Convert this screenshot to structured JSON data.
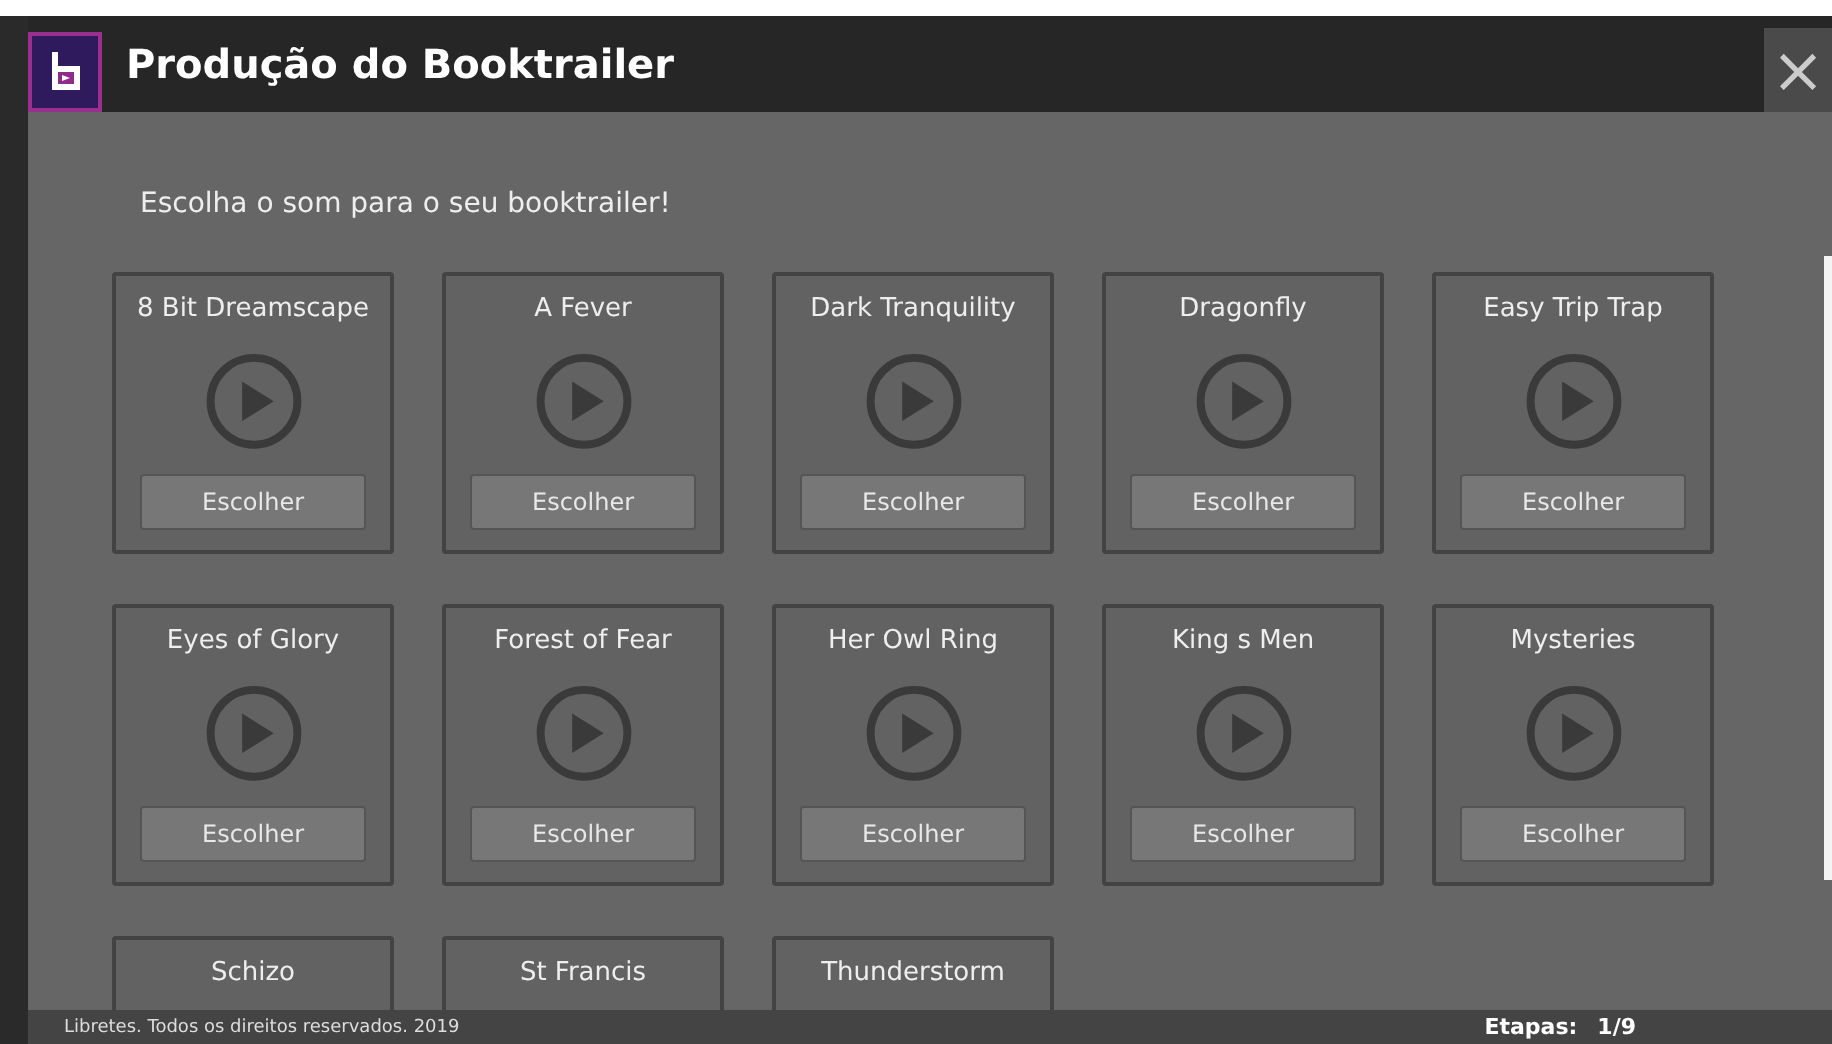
{
  "window": {
    "title": "Produção do Booktrailer",
    "close": "×"
  },
  "prompt": "Escolha o som para o seu booktrailer!",
  "sounds": [
    {
      "name": "8 Bit Dreamscape",
      "button": "Escolher"
    },
    {
      "name": "A Fever",
      "button": "Escolher"
    },
    {
      "name": "Dark Tranquility",
      "button": "Escolher"
    },
    {
      "name": "Dragonfly",
      "button": "Escolher"
    },
    {
      "name": "Easy Trip Trap",
      "button": "Escolher"
    },
    {
      "name": "Eyes of Glory",
      "button": "Escolher"
    },
    {
      "name": "Forest of Fear",
      "button": "Escolher"
    },
    {
      "name": "Her Owl Ring",
      "button": "Escolher"
    },
    {
      "name": "King s Men",
      "button": "Escolher"
    },
    {
      "name": "Mysteries",
      "button": "Escolher"
    },
    {
      "name": "Schizo"
    },
    {
      "name": "St Francis"
    },
    {
      "name": "Thunderstorm"
    }
  ],
  "footer": {
    "copyright": "Libretes. Todos os direitos reservados. 2019",
    "steps_label": "Etapas:",
    "steps_value": "1/9"
  }
}
